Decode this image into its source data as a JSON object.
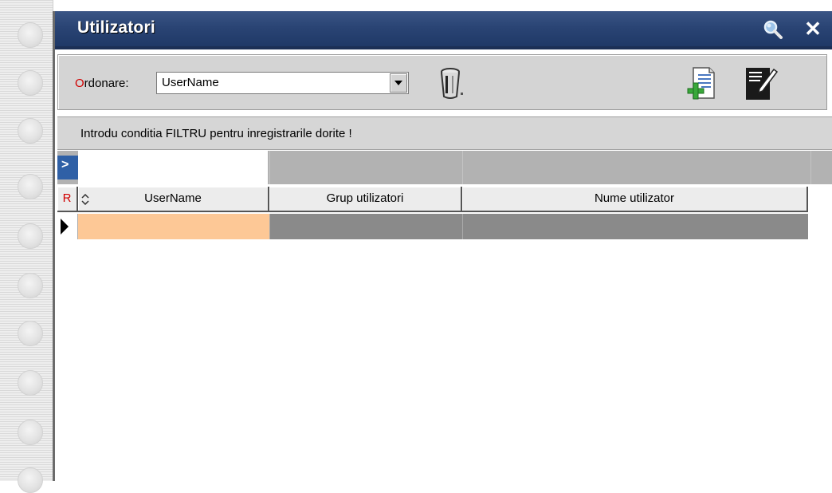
{
  "window": {
    "title": "Utilizatori",
    "search_icon": "search-icon",
    "close_icon": "close-icon"
  },
  "toolbar": {
    "order_label_hot": "O",
    "order_label_rest": "rdonare:",
    "order_value": "UserName",
    "dropdown_icon": "chevron-down-icon",
    "trash_icon": "trash-icon",
    "new_icon": "new-document-icon",
    "edit_icon": "edit-document-icon"
  },
  "filter": {
    "hint": "Introdu conditia FILTRU pentru inregistrarile dorite !",
    "indicator": ">",
    "values": [
      "",
      "",
      ""
    ]
  },
  "grid": {
    "columns": [
      "R",
      "UserName",
      "Grup utilizatori",
      "Nume utilizator"
    ],
    "rows": [
      {
        "username": "",
        "group": "",
        "name": ""
      }
    ]
  },
  "colors": {
    "title_bar": "#2a4474",
    "selected_cell": "#fdc896",
    "filter_indicator": "#2f60a6",
    "hotkey": "#d00000"
  }
}
